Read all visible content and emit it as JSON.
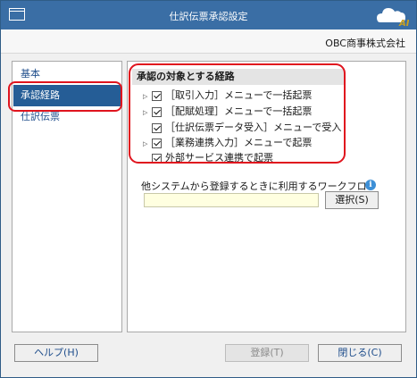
{
  "window": {
    "title": "仕訳伝票承認設定",
    "company": "OBC商事株式会社"
  },
  "nav": {
    "items": [
      {
        "label": "基本",
        "active": false
      },
      {
        "label": "承認経路",
        "active": true
      },
      {
        "label": "仕訳伝票",
        "active": false
      }
    ]
  },
  "routes": {
    "header": "承認の対象とする経路",
    "items": [
      {
        "label": "［取引入力］メニューで一括起票",
        "checked": true,
        "expandable": true
      },
      {
        "label": "［配賦処理］メニューで一括起票",
        "checked": true,
        "expandable": true
      },
      {
        "label": "［仕訳伝票データ受入］メニューで受入",
        "checked": true,
        "expandable": false
      },
      {
        "label": "［業務連携入力］メニューで起票",
        "checked": true,
        "expandable": true
      },
      {
        "label": "外部サービス連携で起票",
        "checked": true,
        "expandable": false
      }
    ]
  },
  "workflow": {
    "label": "他システムから登録するときに利用するワークフロー",
    "value": "",
    "select_label": "選択(S)"
  },
  "footer": {
    "help_label": "ヘルプ(H)",
    "register_label": "登録(T)",
    "close_label": "閉じる(C)"
  },
  "colors": {
    "titlebar": "#3a6ea5",
    "nav_active": "#255d96",
    "highlight": "#e0141e",
    "input_bg": "#ffffe0"
  },
  "icons": {
    "app": "window-icon",
    "logo": "cloud-ai-logo",
    "expand": "triangle-right-icon",
    "info": "info-icon"
  }
}
